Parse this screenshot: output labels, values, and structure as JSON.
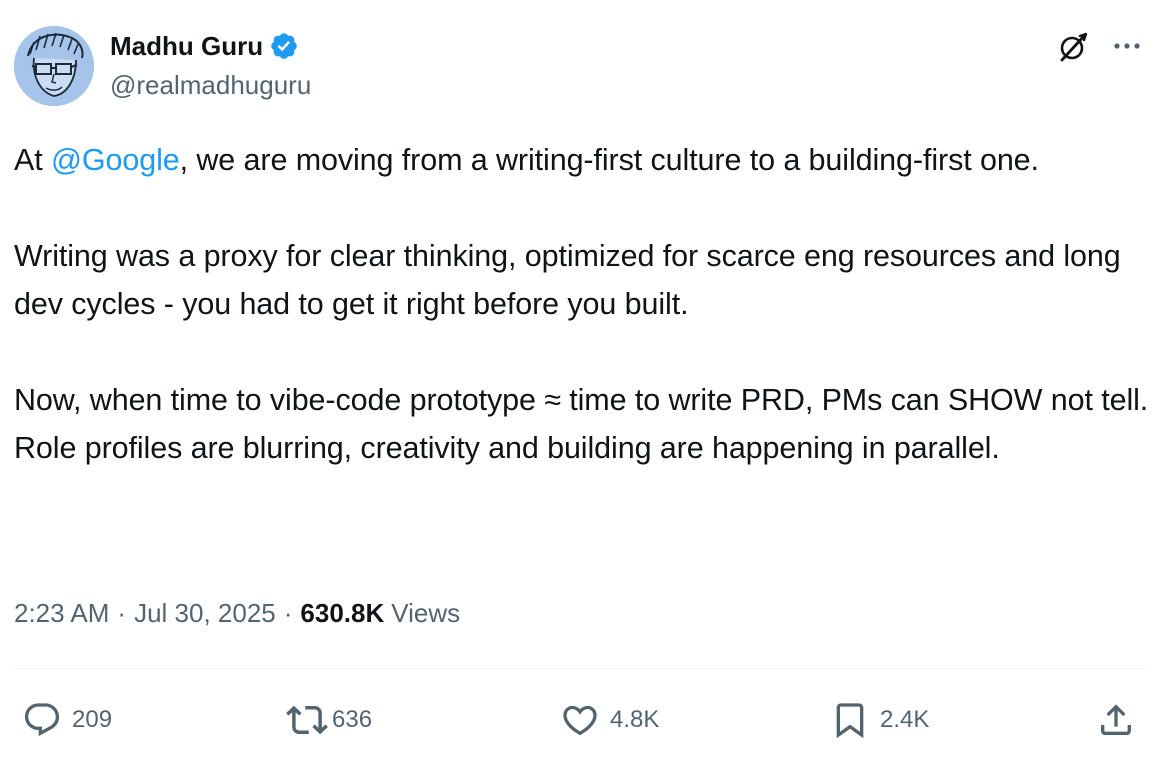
{
  "author": {
    "display_name": "Madhu Guru",
    "handle": "@realmadhuguru",
    "verified": true,
    "verified_color": "#1d9bf0"
  },
  "tweet": {
    "paragraphs": [
      {
        "segments": [
          {
            "text": "At ",
            "type": "text"
          },
          {
            "text": "@Google",
            "type": "mention"
          },
          {
            "text": ", we are moving from a writing-first culture to a building-first one.",
            "type": "text"
          }
        ]
      },
      {
        "segments": [
          {
            "text": "Writing was a proxy for clear thinking, optimized for scarce eng resources and long dev cycles - you had to get it right before you built.",
            "type": "text"
          }
        ]
      },
      {
        "segments": [
          {
            "text": "Now, when time to vibe-code prototype ≈ time to write PRD, PMs can SHOW not tell. Role profiles are blurring, creativity and building are happening in parallel.",
            "type": "text"
          }
        ]
      }
    ]
  },
  "meta": {
    "time": "2:23 AM",
    "separator": "·",
    "date": "Jul 30, 2025",
    "views_count": "630.8K",
    "views_label": "Views"
  },
  "actions": {
    "replies": "209",
    "reposts": "636",
    "likes": "4.8K",
    "bookmarks": "2.4K"
  },
  "icons": {
    "header": [
      "grok-icon",
      "more-icon"
    ],
    "actions": [
      "reply-icon",
      "repost-icon",
      "like-icon",
      "bookmark-icon",
      "share-icon"
    ]
  },
  "colors": {
    "text_primary": "#0f1419",
    "text_secondary": "#536471",
    "accent": "#1d9bf0",
    "divider": "#eff3f4"
  }
}
